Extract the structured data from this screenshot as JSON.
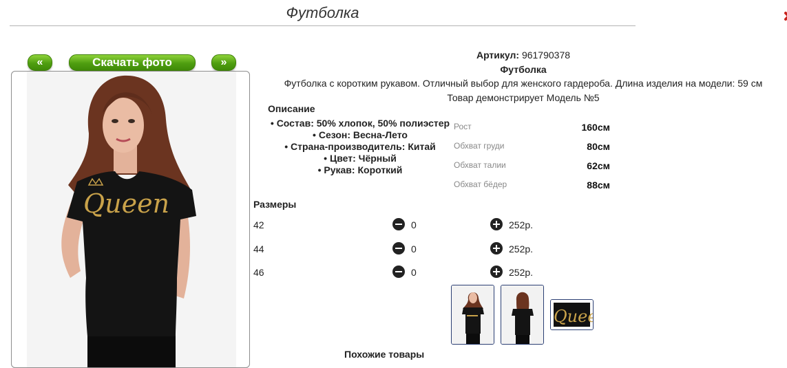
{
  "page": {
    "title": "Футболка"
  },
  "photo": {
    "prev_label": "«",
    "download_label": "Скачать фото",
    "next_label": "»",
    "print_text": "Queen"
  },
  "product": {
    "article_label": "Артикул:",
    "article_value": "961790378",
    "name": "Футболка",
    "description": "Футболка с коротким рукавом. Отличный выбор для женского гардероба. Длина изделия на модели: 59 см",
    "model_line": "Товар демонстрирует Модель №5"
  },
  "description": {
    "heading": "Описание",
    "items": [
      "Состав: 50% хлопок, 50% полиэстер",
      "Сезон: Весна-Лето",
      "Страна-производитель: Китай",
      "Цвет: Чёрный",
      "Рукав: Короткий"
    ]
  },
  "measurements": [
    {
      "label": "Рост",
      "value": "160см"
    },
    {
      "label": "Обхват груди",
      "value": "80см"
    },
    {
      "label": "Обхват талии",
      "value": "62см"
    },
    {
      "label": "Обхват бёдер",
      "value": "88см"
    }
  ],
  "sizes": {
    "heading": "Размеры",
    "rows": [
      {
        "size": "42",
        "qty": "0",
        "price": "252р."
      },
      {
        "size": "44",
        "qty": "0",
        "price": "252р."
      },
      {
        "size": "46",
        "qty": "0",
        "price": "252р."
      }
    ]
  },
  "thumbnails": {
    "close_up_text": "Quee"
  },
  "similar": {
    "heading": "Похожие товары"
  },
  "colors": {
    "accent_green": "#4f9e10",
    "close_red": "#c8241d",
    "thumb_border": "#2a3e73",
    "shirt": "#141414",
    "print_gold": "#c9a24a"
  }
}
